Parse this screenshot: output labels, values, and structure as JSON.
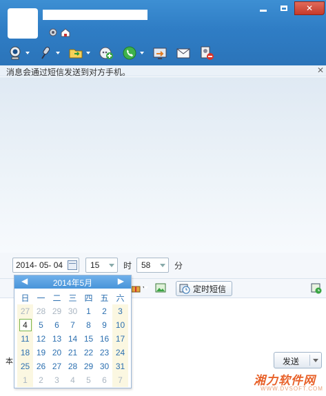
{
  "header": {
    "window_controls": {
      "minimize": "minimize",
      "maximize": "maximize",
      "close": "✕"
    }
  },
  "toolbar": {
    "items": [
      {
        "icon": "webcam-icon",
        "has_dropdown": true
      },
      {
        "icon": "microphone-icon",
        "has_dropdown": true
      },
      {
        "icon": "folder-transfer-icon",
        "has_dropdown": true
      },
      {
        "icon": "add-chat-icon",
        "has_dropdown": false
      },
      {
        "icon": "phone-icon",
        "has_dropdown": true
      },
      {
        "icon": "screen-share-icon",
        "has_dropdown": false
      },
      {
        "icon": "mail-icon",
        "has_dropdown": false
      },
      {
        "icon": "contact-block-icon",
        "has_dropdown": false
      }
    ]
  },
  "notice": {
    "text": "消息会通过短信发送到对方手机。",
    "close": "✕"
  },
  "schedule": {
    "date": "2014- 05- 04",
    "hour": "15",
    "hour_unit": "时",
    "minute": "58",
    "minute_unit": "分"
  },
  "input_tools": {
    "schedule_button": "定时短信"
  },
  "calendar": {
    "prev": "◀",
    "next": "▶",
    "title": "2014年5月",
    "weekdays": [
      "日",
      "一",
      "二",
      "三",
      "四",
      "五",
      "六"
    ],
    "weeks": [
      [
        "27",
        "28",
        "29",
        "30",
        "1",
        "2",
        "3"
      ],
      [
        "4",
        "5",
        "6",
        "7",
        "8",
        "9",
        "10"
      ],
      [
        "11",
        "12",
        "13",
        "14",
        "15",
        "16",
        "17"
      ],
      [
        "18",
        "19",
        "20",
        "21",
        "22",
        "23",
        "24"
      ],
      [
        "25",
        "26",
        "27",
        "28",
        "29",
        "30",
        "31"
      ],
      [
        "1",
        "2",
        "3",
        "4",
        "5",
        "6",
        "7"
      ]
    ],
    "selected": "4"
  },
  "bottom": {
    "left_text": "本",
    "send_label": "发送"
  },
  "watermark": {
    "text": "湘力软件网",
    "url": "WWW.DVSOFT.COM"
  },
  "colors": {
    "header": "#2f7dc5",
    "calendar_head": "#4894d9",
    "weekend_bg": "#fbf7e1",
    "watermark": "#e8622a"
  }
}
